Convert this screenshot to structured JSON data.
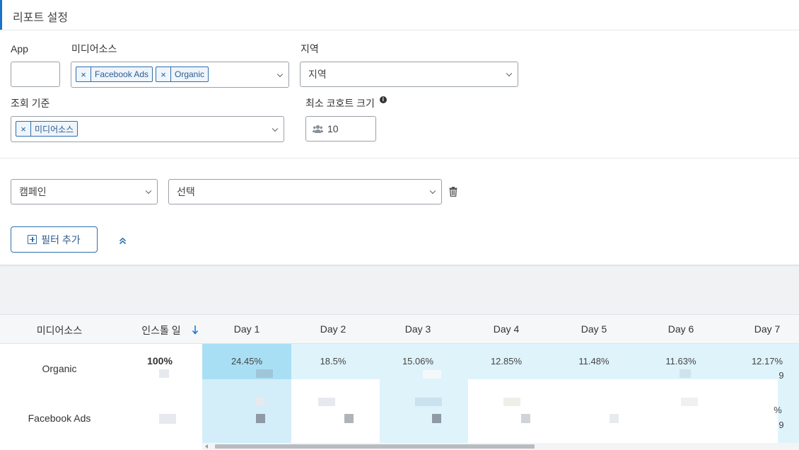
{
  "panel": {
    "title": "리포트 설정"
  },
  "filters": {
    "app_label": "App",
    "media_source_label": "미디어소스",
    "media_source_tags": [
      "Facebook Ads",
      "Organic"
    ],
    "region_label": "지역",
    "region_value": "지역",
    "group_by_label": "조회 기준",
    "group_by_tags": [
      "미디어소스"
    ],
    "min_cohort_label": "최소 코호트 크기",
    "min_cohort_value": "10",
    "campaign_select": "캠페인",
    "campaign_value_select": "선택",
    "add_filter_label": "필터 추가"
  },
  "table": {
    "columns": [
      "미디어소스",
      "인스톨 일",
      "Day 1",
      "Day 2",
      "Day 3",
      "Day 4",
      "Day 5",
      "Day 6",
      "Day 7"
    ],
    "rows": [
      {
        "source": "Organic",
        "install": "100%",
        "days": [
          "24.45%",
          "18.5%",
          "15.06%",
          "12.85%",
          "11.48%",
          "11.63%",
          "12.17%"
        ],
        "day7_sub": "9"
      },
      {
        "source": "Facebook Ads",
        "install": "",
        "days": [
          "",
          "",
          "",
          "",
          "",
          "",
          "%"
        ],
        "day7_sub": "9"
      }
    ]
  },
  "colors": {
    "accent": "#1a73c9",
    "cell_highlight": "#a9dff5",
    "cell_light": "#dff3fb"
  }
}
